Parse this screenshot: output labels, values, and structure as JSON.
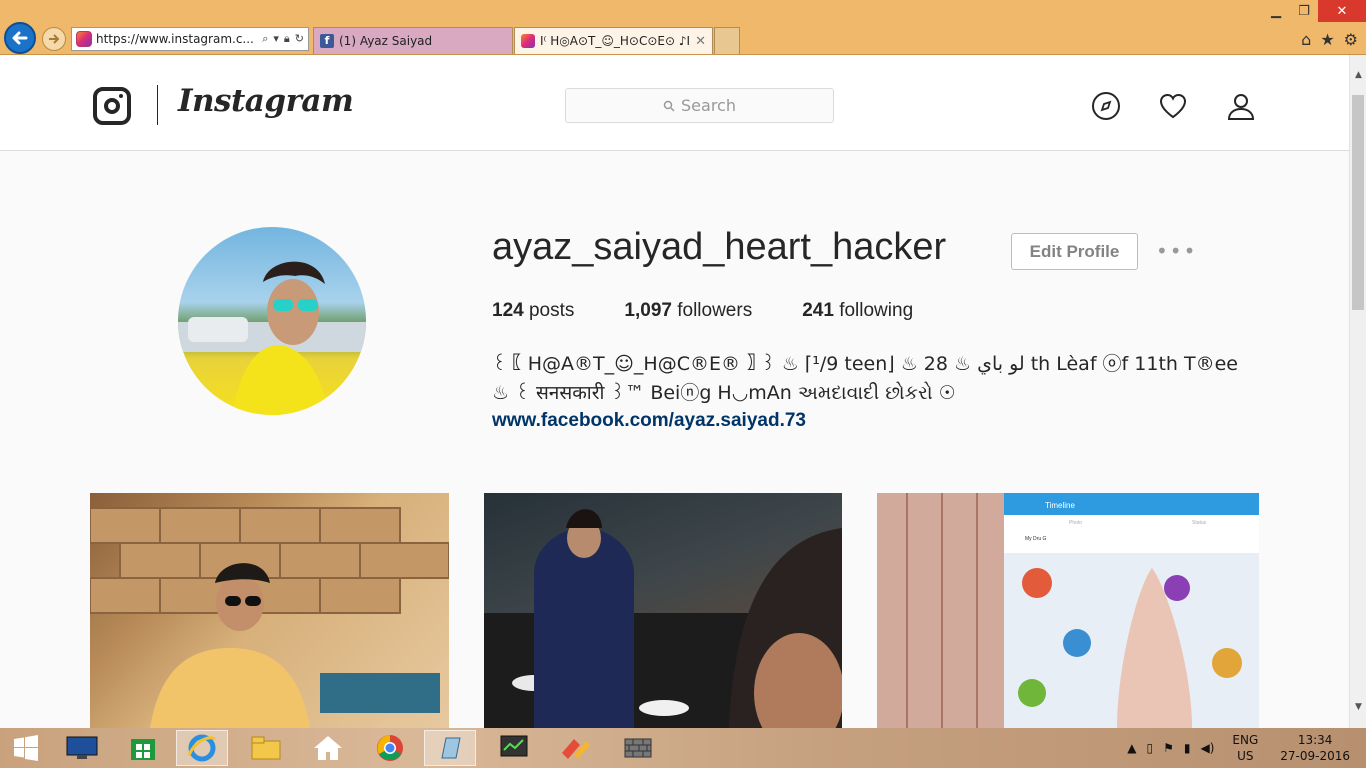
{
  "browser": {
    "url": "https://www.instagram.c...",
    "tabs": [
      {
        "label": "(1) Ayaz Saiyad"
      },
      {
        "label": "I⁽ H◎A⊙T_☺_H⊙C⊙E⊙ ♪I..."
      }
    ]
  },
  "header": {
    "logo_text": "Instagram",
    "search_placeholder": "Search"
  },
  "profile": {
    "username": "ayaz_saiyad_heart_hacker",
    "edit_button": "Edit Profile",
    "more_button": "•••",
    "posts_count": "124",
    "posts_label": "posts",
    "followers_count": "1,097",
    "followers_label": "followers",
    "following_count": "241",
    "following_label": "following",
    "bio_line1": "꒰〖 H@A®T_☺_H@C®E® 〗꒱ ♨ ⌈¹/9 teen⌋ ♨ 28 ♨ لو باي th Lèaf ⓞf 11th T®ee",
    "bio_line2": "♨ ꒰ सनसकारी ꒱™ Beiⓝg H◡mAn અમદાવાદી છોકરો ☉",
    "website": "www.facebook.com/ayaz.saiyad.73"
  },
  "posts": [
    {
      "label": "post-1"
    },
    {
      "label": "post-2"
    },
    {
      "label": "post-3"
    }
  ],
  "post3_screen": {
    "title": "Timeline",
    "tab_photo": "Photo",
    "tab_status": "Status",
    "user": "My Dru G"
  },
  "taskbar": {
    "lang_top": "ENG",
    "lang_bottom": "US",
    "time": "13:34",
    "date": "27-09-2016"
  },
  "colors": {
    "link": "#003569",
    "chrome": "#f0b86a",
    "accent_blue": "#1a73c8"
  }
}
